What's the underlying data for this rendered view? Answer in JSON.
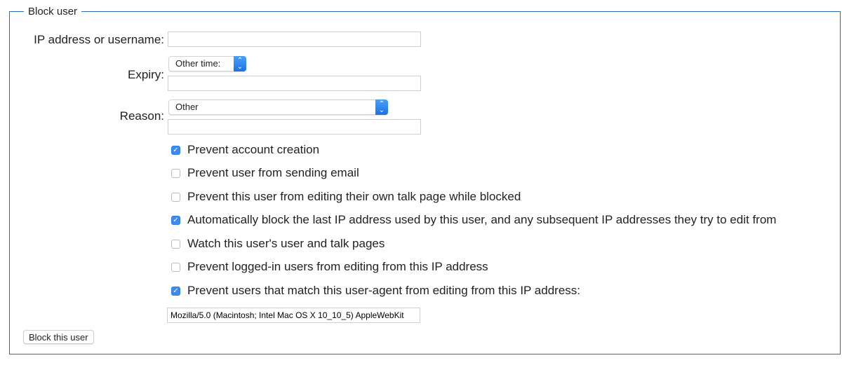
{
  "form": {
    "legend": "Block user",
    "target_label": "IP address or username:",
    "target_value": "",
    "expiry_label": "Expiry:",
    "expiry_selected": "Other time:",
    "expiry_other_value": "",
    "reason_label": "Reason:",
    "reason_selected": "Other",
    "reason_other_value": "",
    "options": [
      {
        "label": "Prevent account creation",
        "checked": true
      },
      {
        "label": "Prevent user from sending email",
        "checked": false
      },
      {
        "label": "Prevent this user from editing their own talk page while blocked",
        "checked": false
      },
      {
        "label": "Automatically block the last IP address used by this user, and any subsequent IP addresses they try to edit from",
        "checked": true
      },
      {
        "label": "Watch this user's user and talk pages",
        "checked": false
      },
      {
        "label": "Prevent logged-in users from editing from this IP address",
        "checked": false
      },
      {
        "label": "Prevent users that match this user-agent from editing from this IP address:",
        "checked": true
      }
    ],
    "user_agent_value": "Mozilla/5.0 (Macintosh; Intel Mac OS X 10_10_5) AppleWebKit",
    "submit_label": "Block this user"
  },
  "colors": {
    "accent": "#3b8bf2",
    "border": "#2a6cb3"
  }
}
